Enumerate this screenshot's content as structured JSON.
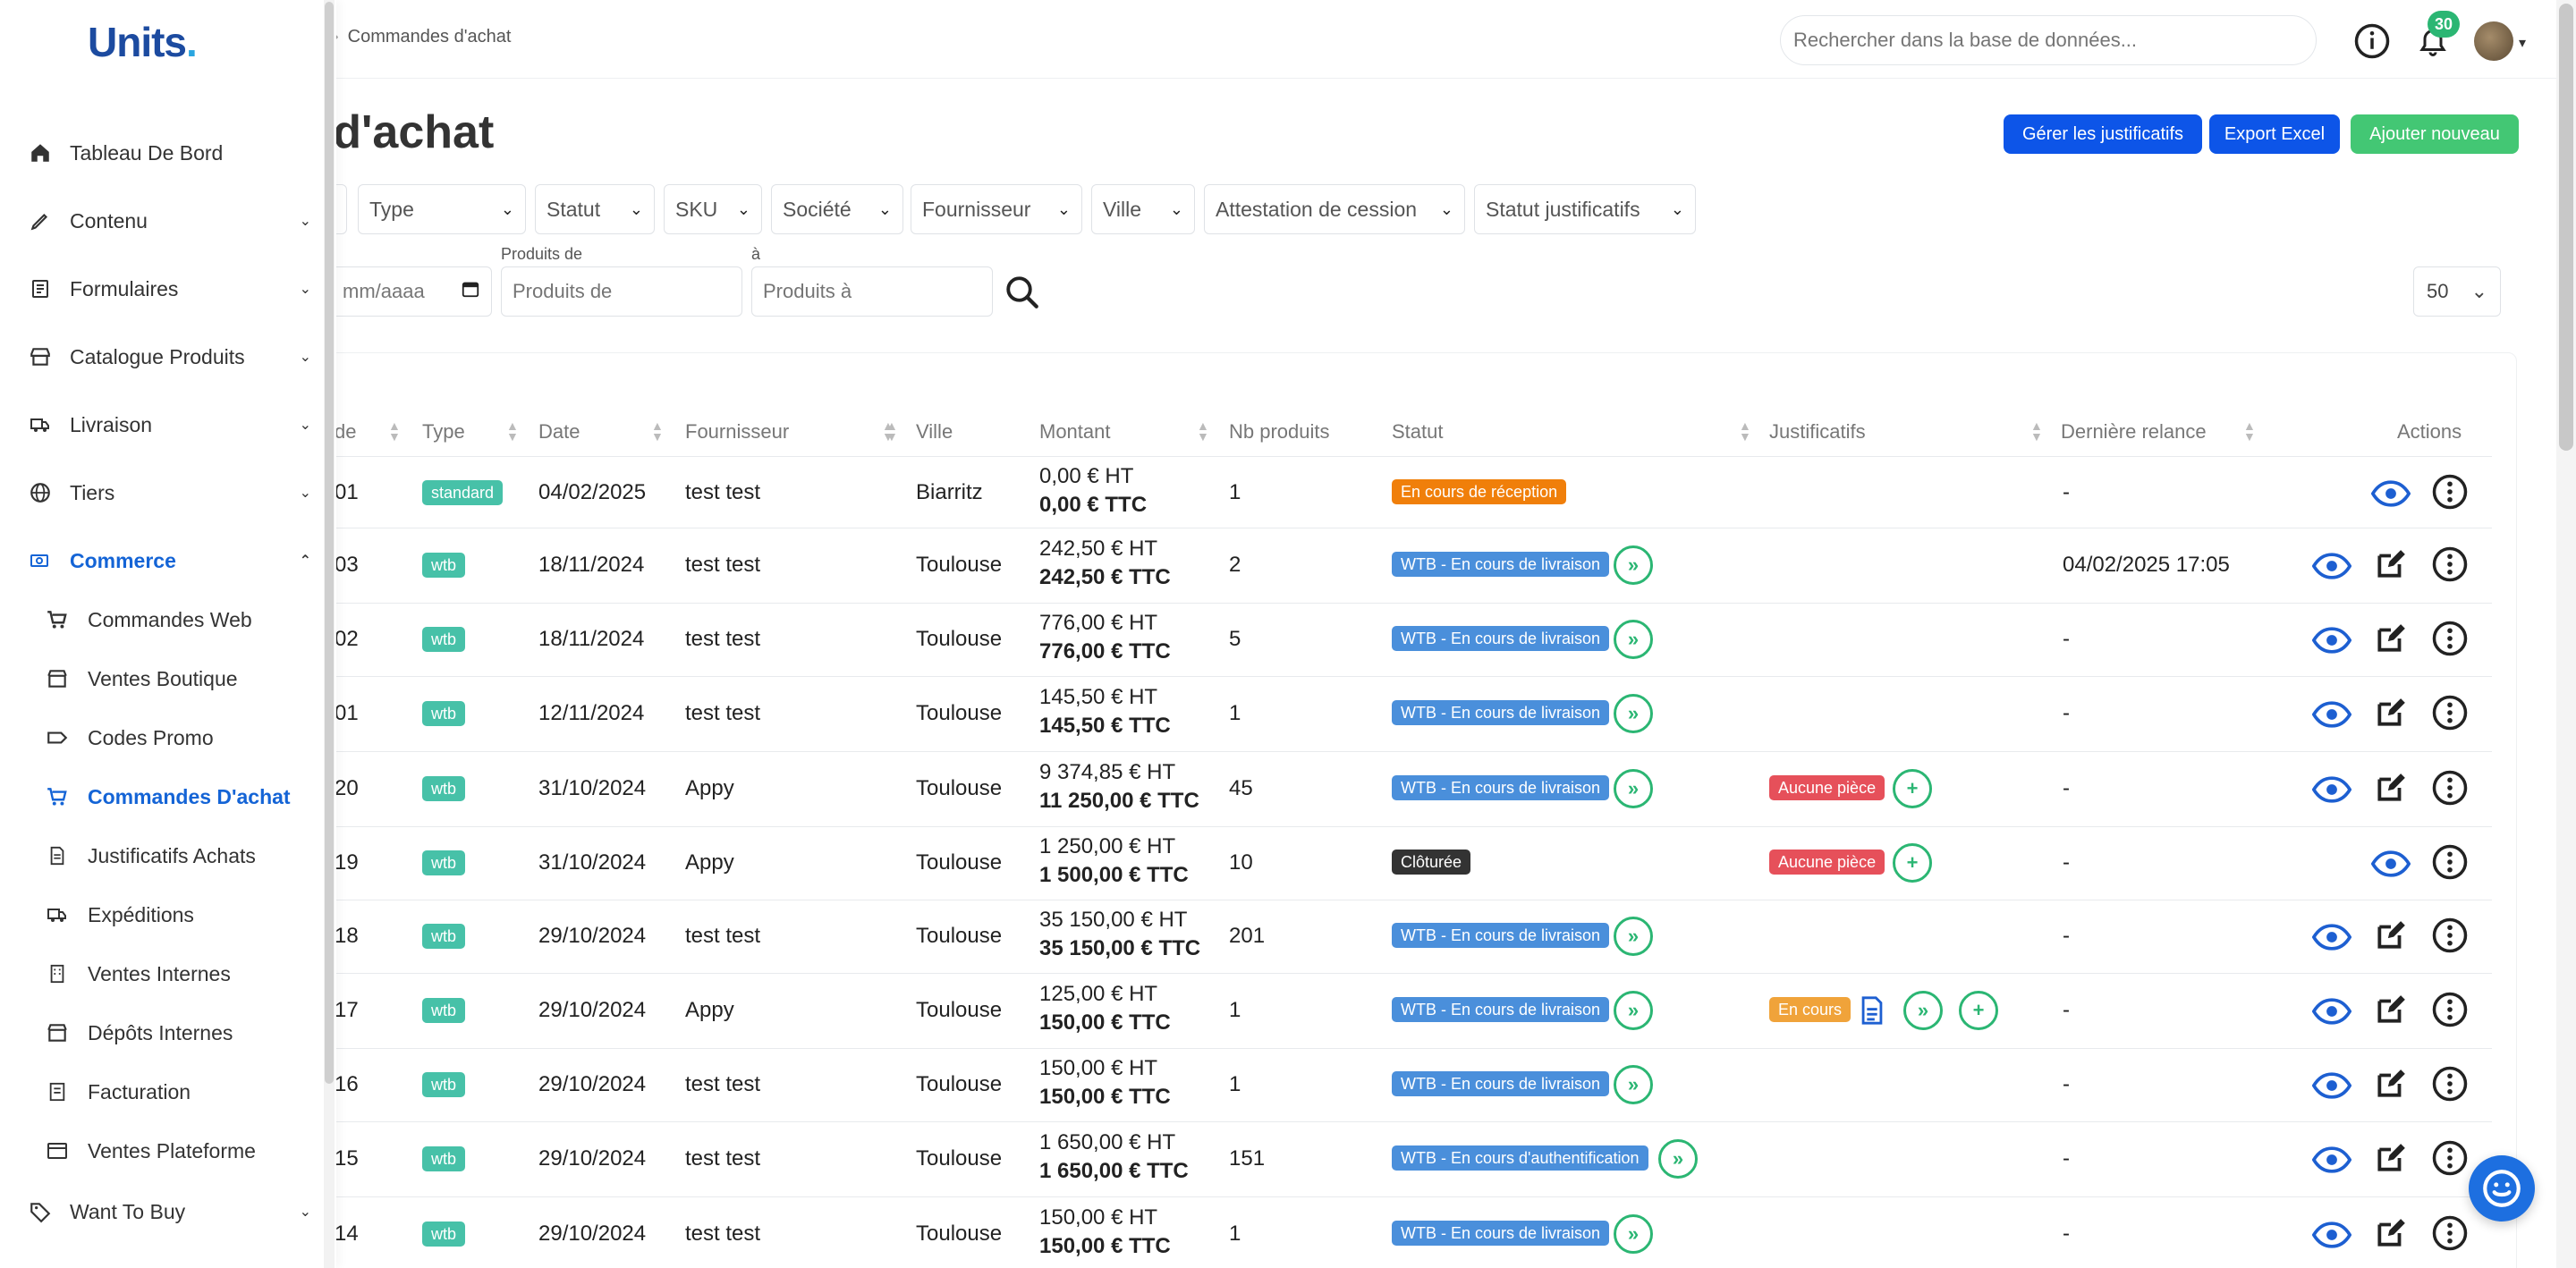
{
  "brand": {
    "logo_text": "Units",
    "logo_dot": "."
  },
  "breadcrumb": {
    "current": "Commandes d'achat"
  },
  "search": {
    "placeholder": "Rechercher dans la base de données..."
  },
  "notifications": {
    "count": "30"
  },
  "page": {
    "title": "es d'achat"
  },
  "actions": {
    "manage_docs": "Gérer les justificatifs",
    "export": "Export Excel",
    "add_new": "Ajouter nouveau"
  },
  "filters": [
    {
      "label": "Type"
    },
    {
      "label": "Statut"
    },
    {
      "label": "SKU"
    },
    {
      "label": "Société"
    },
    {
      "label": "Fournisseur"
    },
    {
      "label": "Ville"
    },
    {
      "label": "Attestation de cession"
    },
    {
      "label": "Statut justificatifs"
    }
  ],
  "range": {
    "date_placeholder": "mm/aaaa",
    "products_from_label": "Produits de",
    "products_from_placeholder": "Produits de",
    "products_to_label": "à",
    "products_to_placeholder": "Produits à"
  },
  "per_page": {
    "value": "50"
  },
  "table": {
    "headers": {
      "code": "de",
      "type": "Type",
      "date": "Date",
      "supplier": "Fournisseur",
      "city": "Ville",
      "amount": "Montant",
      "count": "Nb produits",
      "status": "Statut",
      "docs": "Justificatifs",
      "reminder": "Dernière relance",
      "actions": "Actions"
    },
    "rows": [
      {
        "code": "01",
        "type": "standard",
        "date": "04/02/2025",
        "supplier": "test test",
        "city": "Biarritz",
        "ht": "0,00 € HT",
        "ttc": "0,00 € TTC",
        "count": "1",
        "status": "En cours de réception",
        "docs": "",
        "reminder": "-"
      },
      {
        "code": "03",
        "type": "wtb",
        "date": "18/11/2024",
        "supplier": "test test",
        "city": "Toulouse",
        "ht": "242,50 € HT",
        "ttc": "242,50 € TTC",
        "count": "2",
        "status": "WTB - En cours de livraison",
        "docs": "",
        "reminder": "04/02/2025 17:05"
      },
      {
        "code": "02",
        "type": "wtb",
        "date": "18/11/2024",
        "supplier": "test test",
        "city": "Toulouse",
        "ht": "776,00 € HT",
        "ttc": "776,00 € TTC",
        "count": "5",
        "status": "WTB - En cours de livraison",
        "docs": "",
        "reminder": "-"
      },
      {
        "code": "01",
        "type": "wtb",
        "date": "12/11/2024",
        "supplier": "test test",
        "city": "Toulouse",
        "ht": "145,50 € HT",
        "ttc": "145,50 € TTC",
        "count": "1",
        "status": "WTB - En cours de livraison",
        "docs": "",
        "reminder": "-"
      },
      {
        "code": "20",
        "type": "wtb",
        "date": "31/10/2024",
        "supplier": "Appy",
        "city": "Toulouse",
        "ht": "9 374,85 € HT",
        "ttc": "11 250,00 € TTC",
        "count": "45",
        "status": "WTB - En cours de livraison",
        "docs": "Aucune pièce",
        "reminder": "-"
      },
      {
        "code": "19",
        "type": "wtb",
        "date": "31/10/2024",
        "supplier": "Appy",
        "city": "Toulouse",
        "ht": "1 250,00 € HT",
        "ttc": "1 500,00 € TTC",
        "count": "10",
        "status": "Clôturée",
        "docs": "Aucune pièce",
        "reminder": "-"
      },
      {
        "code": "18",
        "type": "wtb",
        "date": "29/10/2024",
        "supplier": "test test",
        "city": "Toulouse",
        "ht": "35 150,00 € HT",
        "ttc": "35 150,00 € TTC",
        "count": "201",
        "status": "WTB - En cours de livraison",
        "docs": "",
        "reminder": "-"
      },
      {
        "code": "17",
        "type": "wtb",
        "date": "29/10/2024",
        "supplier": "Appy",
        "city": "Toulouse",
        "ht": "125,00 € HT",
        "ttc": "150,00 € TTC",
        "count": "1",
        "status": "WTB - En cours de livraison",
        "docs": "En cours",
        "reminder": "-"
      },
      {
        "code": "16",
        "type": "wtb",
        "date": "29/10/2024",
        "supplier": "test test",
        "city": "Toulouse",
        "ht": "150,00 € HT",
        "ttc": "150,00 € TTC",
        "count": "1",
        "status": "WTB - En cours de livraison",
        "docs": "",
        "reminder": "-"
      },
      {
        "code": "15",
        "type": "wtb",
        "date": "29/10/2024",
        "supplier": "test test",
        "city": "Toulouse",
        "ht": "1 650,00 € HT",
        "ttc": "1 650,00 € TTC",
        "count": "151",
        "status": "WTB - En cours d'authentification",
        "docs": "",
        "reminder": "-"
      },
      {
        "code": "14",
        "type": "wtb",
        "date": "29/10/2024",
        "supplier": "test test",
        "city": "Toulouse",
        "ht": "150,00 € HT",
        "ttc": "150,00 € TTC",
        "count": "1",
        "status": "WTB - En cours de livraison",
        "docs": "",
        "reminder": "-"
      }
    ]
  },
  "sidebar": {
    "items": [
      {
        "label": "Tableau De Bord",
        "icon": "home-icon"
      },
      {
        "label": "Contenu",
        "icon": "brush-icon"
      },
      {
        "label": "Formulaires",
        "icon": "form-icon"
      },
      {
        "label": "Catalogue Produits",
        "icon": "store-icon"
      },
      {
        "label": "Livraison",
        "icon": "truck-icon"
      },
      {
        "label": "Tiers",
        "icon": "globe-icon"
      },
      {
        "label": "Commerce",
        "icon": "money-icon"
      },
      {
        "label": "Want To Buy",
        "icon": "tag-icon"
      }
    ],
    "subitems": [
      {
        "label": "Commandes Web",
        "icon": "cart-icon"
      },
      {
        "label": "Ventes Boutique",
        "icon": "shop-icon"
      },
      {
        "label": "Codes Promo",
        "icon": "coupon-icon"
      },
      {
        "label": "Commandes D'achat",
        "icon": "cart-icon"
      },
      {
        "label": "Justificatifs Achats",
        "icon": "document-icon"
      },
      {
        "label": "Expéditions",
        "icon": "truck-icon"
      },
      {
        "label": "Ventes Internes",
        "icon": "building-icon"
      },
      {
        "label": "Dépôts Internes",
        "icon": "shop-icon"
      },
      {
        "label": "Facturation",
        "icon": "invoice-icon"
      },
      {
        "label": "Ventes Plateforme",
        "icon": "window-icon"
      }
    ]
  },
  "colors": {
    "primary": "#0d55e8",
    "success": "#43c774",
    "accent": "#1464d6",
    "status_blue": "#4a8fdb",
    "status_orange": "#f07f0a",
    "status_dark": "#333333",
    "status_red": "#e6505a",
    "status_amber": "#f0a33a"
  }
}
